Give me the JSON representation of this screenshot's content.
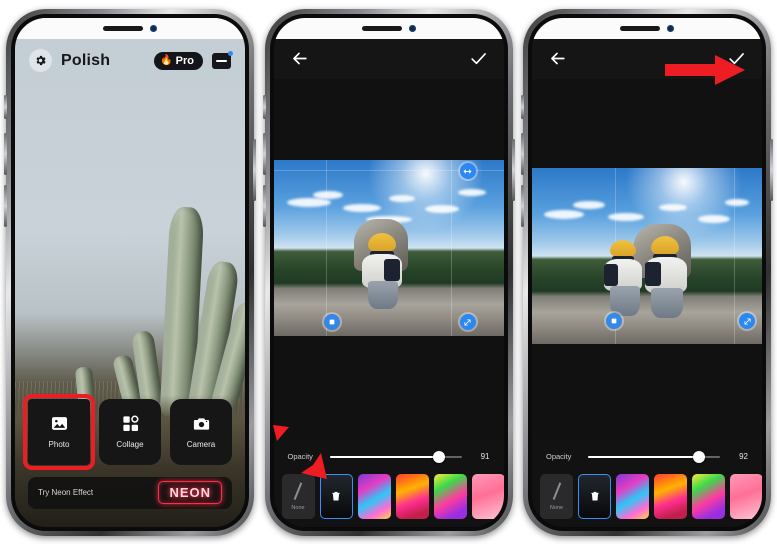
{
  "screens": [
    {
      "name": "home",
      "header": {
        "gear_icon": "gear-icon",
        "title": "Polish",
        "pro_badge": {
          "flame": "🔥",
          "label": "Pro"
        },
        "store_icon": "store-icon",
        "badge_dot": "notification-dot"
      },
      "actions": [
        {
          "icon": "photo-icon",
          "label": "Photo",
          "highlighted": true
        },
        {
          "icon": "collage-icon",
          "label": "Collage",
          "highlighted": false
        },
        {
          "icon": "camera-icon",
          "label": "Camera",
          "highlighted": false
        }
      ],
      "promo": {
        "text": "Try Neon Effect",
        "chip": "NEON"
      }
    },
    {
      "name": "editor-step-1",
      "topbar": {
        "back_icon": "back-arrow-icon",
        "confirm_icon": "check-icon"
      },
      "opacity": {
        "label": "Opacity",
        "value": "91",
        "percent": 83
      },
      "filters": [
        {
          "name": "None",
          "label": "None",
          "selected": false
        },
        {
          "name": "Eraser",
          "label": "",
          "selected": true
        },
        {
          "name": "Filter1",
          "label": "",
          "selected": false
        },
        {
          "name": "Filter2",
          "label": "",
          "selected": false
        },
        {
          "name": "Filter3",
          "label": "",
          "selected": false
        },
        {
          "name": "Filter4",
          "label": "",
          "selected": false
        }
      ],
      "annotation": "red-arrow-pointing-to-eraser-filter"
    },
    {
      "name": "editor-step-2",
      "topbar": {
        "back_icon": "back-arrow-icon",
        "confirm_icon": "check-icon"
      },
      "opacity": {
        "label": "Opacity",
        "value": "92",
        "percent": 84
      },
      "filters": [
        {
          "name": "None",
          "label": "None",
          "selected": false
        },
        {
          "name": "Eraser",
          "label": "",
          "selected": true
        },
        {
          "name": "Filter1",
          "label": "",
          "selected": false
        },
        {
          "name": "Filter2",
          "label": "",
          "selected": false
        },
        {
          "name": "Filter3",
          "label": "",
          "selected": false
        },
        {
          "name": "Filter4",
          "label": "",
          "selected": false
        }
      ],
      "annotation": "red-arrow-pointing-to-confirm-check"
    }
  ],
  "colors": {
    "accent_red": "#ee1d24",
    "selection_blue": "#3d8ef7",
    "handle_blue": "#2b87f2",
    "neon_red": "#ff2d47",
    "panel_dark": "#121213"
  }
}
